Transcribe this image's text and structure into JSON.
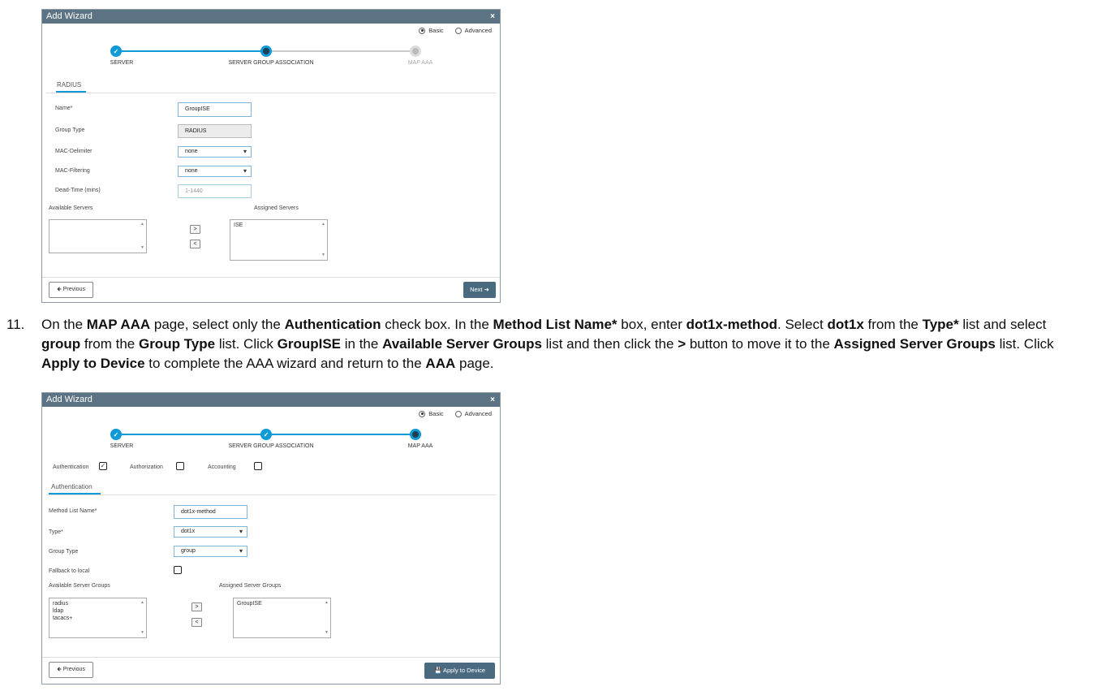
{
  "wizard1": {
    "title": "Add Wizard",
    "close": "×",
    "modes": {
      "basic": "Basic",
      "advanced": "Advanced"
    },
    "steps": [
      "SERVER",
      "SERVER GROUP ASSOCIATION",
      "MAP AAA"
    ],
    "tab": "RADIUS",
    "fields": {
      "name_label": "Name*",
      "name_value": "GroupISE",
      "group_type_label": "Group Type",
      "group_type_value": "RADIUS",
      "mac_delim_label": "MAC-Delimiter",
      "mac_delim_value": "none",
      "mac_filter_label": "MAC-Filtering",
      "mac_filter_value": "none",
      "dead_time_label": "Dead-Time (mins)",
      "dead_time_placeholder": "1-1440"
    },
    "available_label": "Available Servers",
    "assigned_label": "Assigned Servers",
    "assigned_items": [
      "ISE"
    ],
    "move_right": ">",
    "move_left": "<",
    "prev": "Previous",
    "next": "Next"
  },
  "instruction": {
    "number": "11.",
    "parts": [
      {
        "t": "On the ",
        "b": false
      },
      {
        "t": "MAP AAA",
        "b": true
      },
      {
        "t": " page, select only the ",
        "b": false
      },
      {
        "t": "Authentication",
        "b": true
      },
      {
        "t": " check box. In the ",
        "b": false
      },
      {
        "t": "Method List Name*",
        "b": true
      },
      {
        "t": " box, enter ",
        "b": false
      },
      {
        "t": "dot1x-method",
        "b": true
      },
      {
        "t": ". Select ",
        "b": false
      },
      {
        "t": "dot1x",
        "b": true
      },
      {
        "t": " from the ",
        "b": false
      },
      {
        "t": "Type*",
        "b": true
      },
      {
        "t": " list and select ",
        "b": false
      },
      {
        "t": "group",
        "b": true
      },
      {
        "t": " from the ",
        "b": false
      },
      {
        "t": "Group Type",
        "b": true
      },
      {
        "t": " list. Click ",
        "b": false
      },
      {
        "t": "GroupISE",
        "b": true
      },
      {
        "t": " in the ",
        "b": false
      },
      {
        "t": "Available Server Groups",
        "b": true
      },
      {
        "t": " list and then click the ",
        "b": false
      },
      {
        "t": ">",
        "b": true
      },
      {
        "t": " button to move it to the ",
        "b": false
      },
      {
        "t": "Assigned Server Groups",
        "b": true
      },
      {
        "t": " list. Click ",
        "b": false
      },
      {
        "t": "Apply to Device",
        "b": true
      },
      {
        "t": " to complete the AAA wizard and return to the ",
        "b": false
      },
      {
        "t": "AAA",
        "b": true
      },
      {
        "t": " page.",
        "b": false
      }
    ]
  },
  "wizard2": {
    "title": "Add Wizard",
    "close": "×",
    "modes": {
      "basic": "Basic",
      "advanced": "Advanced"
    },
    "steps": [
      "SERVER",
      "SERVER GROUP ASSOCIATION",
      "MAP AAA"
    ],
    "checks": {
      "authentication": "Authentication",
      "authorization": "Authorization",
      "accounting": "Accounting"
    },
    "authentication_checked": true,
    "tab": "Authentication",
    "fields": {
      "method_label": "Method List Name*",
      "method_value": "dot1x-method",
      "type_label": "Type*",
      "type_value": "dot1x",
      "group_type_label": "Group Type",
      "group_type_value": "group",
      "fallback_label": "Fallback to local"
    },
    "available_label": "Available Server Groups",
    "assigned_label": "Assigned Server Groups",
    "available_items": [
      "radius",
      "ldap",
      "tacacs+"
    ],
    "assigned_items": [
      "GroupISE"
    ],
    "move_right": ">",
    "move_left": "<",
    "prev": "Previous",
    "apply": "Apply to Device"
  }
}
